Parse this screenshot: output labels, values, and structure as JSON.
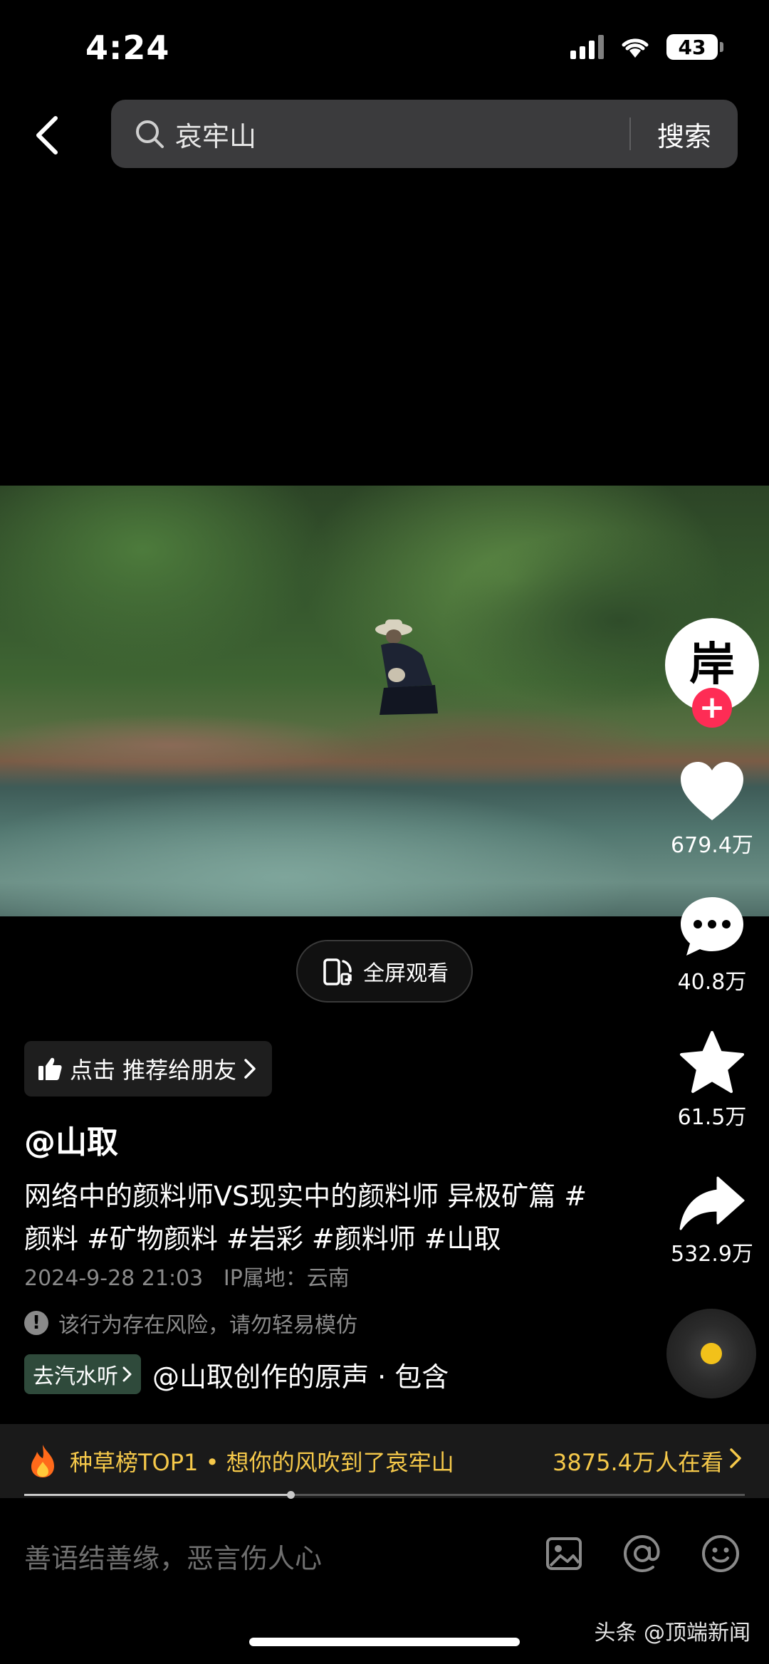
{
  "status_bar": {
    "time": "4:24",
    "battery": "43"
  },
  "search": {
    "query": "哀牢山",
    "button_label": "搜索"
  },
  "video": {
    "fullscreen_label": "全屏观看"
  },
  "author_avatar": {
    "glyph": "岸"
  },
  "actions": {
    "likes": "679.4万",
    "comments": "40.8万",
    "favorites": "61.5万",
    "shares": "532.9万"
  },
  "recommend": {
    "label": "点击 推荐给朋友"
  },
  "post": {
    "author": "@山取",
    "description": "网络中的颜料师VS现实中的颜料师 异极矿篇 #颜料 #矿物颜料 #岩彩 #颜料师 #山取",
    "datetime": "2024-9-28 21:03",
    "ip_location": "IP属地：云南",
    "risk_warning": "该行为存在风险，请勿轻易模仿",
    "music_tag": "去汽水听",
    "music_title": "@山取创作的原声 · 包含"
  },
  "hot_banner": {
    "text": "种草榜TOP1 • 想你的风吹到了哀牢山",
    "viewers": "3875.4万人在看"
  },
  "playback": {
    "progress": 0.37
  },
  "comment_bar": {
    "placeholder": "善语结善缘，恶言伤人心"
  },
  "watermark": {
    "text": "头条 @顶端新闻"
  },
  "colors": {
    "accent_red": "#fe2c55",
    "hot_gold": "#f6c94a",
    "disc_yellow": "#f2c11a"
  }
}
